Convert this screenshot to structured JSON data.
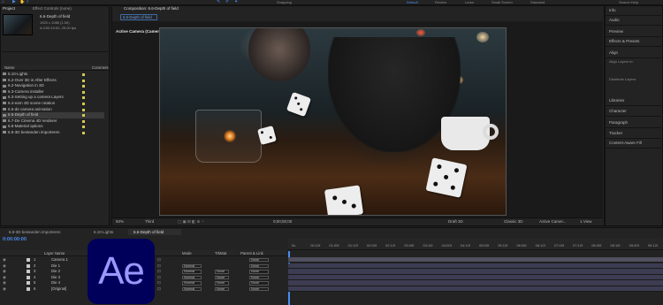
{
  "app": {
    "workspaces": [
      "Default",
      "Review",
      "Learn",
      "Small Screen",
      "Standard"
    ],
    "search_help": "Search Help",
    "toolbar_snapping": "Snapping"
  },
  "project_panel": {
    "tabs": [
      "Project",
      "Effect Controls (none)"
    ],
    "comp_name": "6.6-Depth of field",
    "comp_info_1": "1920 x 1080 (1.00)",
    "comp_info_2": "Δ 0:00:10:00, 25.00 fps",
    "col_name": "Name",
    "col_comment": "Comment",
    "items": [
      "6.10-Lights",
      "6.2-Over 3D in After Effects",
      "6.2-Navigation in 3D",
      "6.3-Camera installer",
      "6.3-Setting up a camera Layers",
      "6.4-earn 3D scene rotation",
      "6.5-de camera animation",
      "6.6-Depth of field",
      "6.7-De Cinema 4D renderer",
      "6.8-Material options",
      "6.9-3D bestanden importeren"
    ],
    "selected_index": 7
  },
  "viewer": {
    "tab_label": "Composition: 6.6-Depth of field",
    "breadcrumb": "6.6-Depth of field",
    "camera_label": "Active Camera (Camera",
    "zoom": "50%",
    "resolution": "Third",
    "timecode": "0;00;00;00",
    "renderer": "Draft 3D",
    "classic": "Classic 3D",
    "camera_select": "Active Camer...",
    "views": "1 View"
  },
  "right_panel": {
    "items": [
      "Info",
      "Audio",
      "Preview",
      "Effects & Presets",
      "Align",
      "Align Layers to:",
      "Distribute Layers:",
      "Libraries",
      "Character",
      "Paragraph",
      "Tracker",
      "Content-Aware Fill"
    ]
  },
  "timeline": {
    "tabs": [
      "6.9-3D bestanden importeren",
      "6.10-Lights",
      "6.6-Depth of field"
    ],
    "active_tab": 2,
    "timecode": "0:00:00:00",
    "columns": {
      "layer_name": "Layer Name",
      "mode": "Mode",
      "trkmat": "TrkMat",
      "parent": "Parent & Link"
    },
    "ruler": [
      "0s",
      "00:12f",
      "01:00f",
      "01:12f",
      "02:00f",
      "02:12f",
      "03:00f",
      "03:12f",
      "04:00f",
      "04:12f",
      "05:00f",
      "05:12f",
      "06:00f",
      "06:12f",
      "07:00f",
      "07:12f",
      "08:00f",
      "08:12f",
      "09:00f",
      "09:12f"
    ],
    "layers": [
      {
        "num": "1",
        "name": "Camera 1",
        "mode": "",
        "trkmat": "",
        "parent": "None"
      },
      {
        "num": "2",
        "name": "Die 1",
        "mode": "Normal",
        "trkmat": "",
        "parent": "None"
      },
      {
        "num": "3",
        "name": "Die 2",
        "mode": "Normal",
        "trkmat": "None",
        "parent": "None"
      },
      {
        "num": "4",
        "name": "Die 3",
        "mode": "Normal",
        "trkmat": "None",
        "parent": "None"
      },
      {
        "num": "5",
        "name": "Die 4",
        "mode": "Normal",
        "trkmat": "None",
        "parent": "None"
      },
      {
        "num": "6",
        "name": "[Original]",
        "mode": "Normal",
        "trkmat": "None",
        "parent": "None"
      }
    ]
  },
  "logo": {
    "text": "Ae",
    "bg": "#00005b",
    "fg": "#9999ff"
  }
}
